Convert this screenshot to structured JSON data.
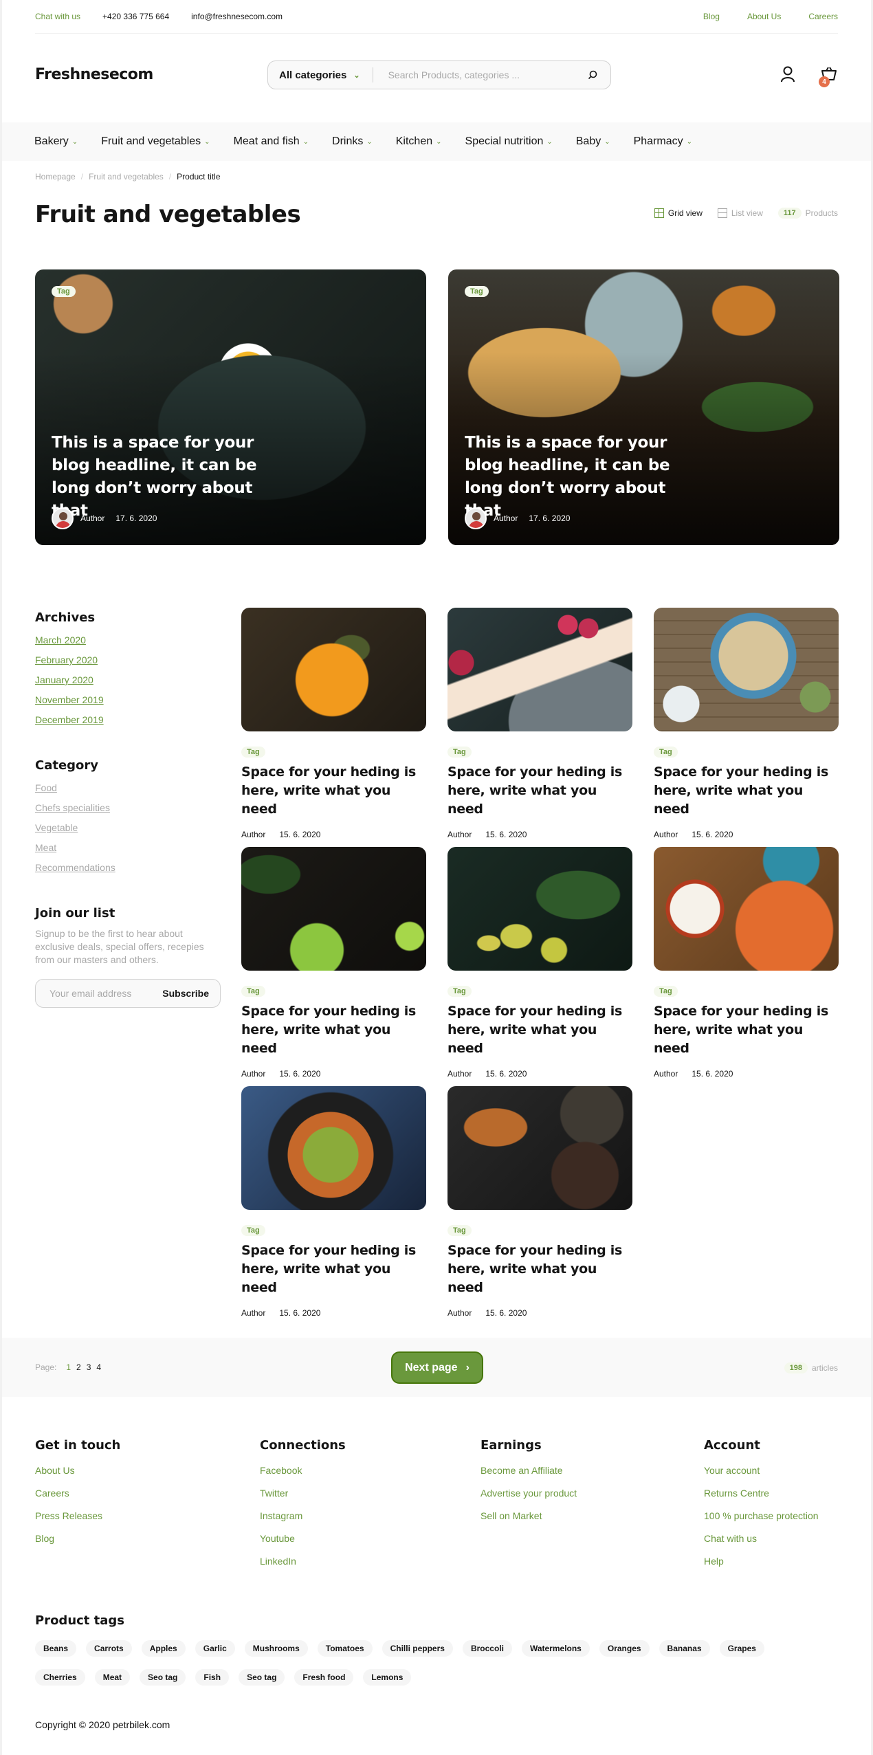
{
  "topbar": {
    "chat": "Chat with us",
    "phone": "+420 336 775 664",
    "email": "info@freshnesecom.com",
    "links": [
      "Blog",
      "About Us",
      "Careers"
    ]
  },
  "header": {
    "logo": "Freshnesecom",
    "category": "All categories",
    "search_placeholder": "Search Products, categories ...",
    "cart_count": "4"
  },
  "nav": [
    "Bakery",
    "Fruit and vegetables",
    "Meat and fish",
    "Drinks",
    "Kitchen",
    "Special nutrition",
    "Baby",
    "Pharmacy"
  ],
  "breadcrumb": [
    "Homepage",
    "Fruit and vegetables",
    "Product title"
  ],
  "page_title": "Fruit and vegetables",
  "view": {
    "grid": "Grid view",
    "list": "List view",
    "count": "117",
    "count_label": "Products"
  },
  "featured": [
    {
      "tag": "Tag",
      "title": "This is a space for your blog headline, it can be long don’t worry about that",
      "author": "Author",
      "date": "17. 6. 2020"
    },
    {
      "tag": "Tag",
      "title": "This is a space for your blog headline, it can be long don’t worry about that",
      "author": "Author",
      "date": "17. 6. 2020"
    }
  ],
  "sidebar": {
    "archives_title": "Archives",
    "archives": [
      "March 2020",
      "February 2020",
      "January 2020",
      "November 2019",
      "December 2019"
    ],
    "category_title": "Category",
    "categories": [
      "Food",
      "Chefs specialities",
      "Vegetable",
      "Meat",
      "Recommendations"
    ],
    "join_title": "Join our list",
    "join_desc": "Signup to be the first to hear about exclusive deals, special offers, recepies from our masters and others.",
    "email_placeholder": "Your email address",
    "subscribe": "Subscribe"
  },
  "posts": [
    {
      "tag": "Tag",
      "title": "Space for your heding is here, write what you need",
      "author": "Author",
      "date": "15. 6. 2020"
    },
    {
      "tag": "Tag",
      "title": "Space for your heding is here, write what you need",
      "author": "Author",
      "date": "15. 6. 2020"
    },
    {
      "tag": "Tag",
      "title": "Space for your heding is here, write what you need",
      "author": "Author",
      "date": "15. 6. 2020"
    },
    {
      "tag": "Tag",
      "title": "Space for your heding is here, write what you need",
      "author": "Author",
      "date": "15. 6. 2020"
    },
    {
      "tag": "Tag",
      "title": "Space for your heding is here, write what you need",
      "author": "Author",
      "date": "15. 6. 2020"
    },
    {
      "tag": "Tag",
      "title": "Space for your heding is here, write what you need",
      "author": "Author",
      "date": "15. 6. 2020"
    },
    {
      "tag": "Tag",
      "title": "Space for your heding is here, write what you need",
      "author": "Author",
      "date": "15. 6. 2020"
    },
    {
      "tag": "Tag",
      "title": "Space for your heding is here, write what you need",
      "author": "Author",
      "date": "15. 6. 2020"
    }
  ],
  "pagination": {
    "label": "Page:",
    "pages": [
      "1",
      "2",
      "3",
      "4"
    ],
    "next": "Next page",
    "count": "198",
    "count_label": "articles"
  },
  "footer": {
    "cols": [
      {
        "title": "Get in touch",
        "links": [
          "About Us",
          "Careers",
          "Press Releases",
          "Blog"
        ]
      },
      {
        "title": "Connections",
        "links": [
          "Facebook",
          "Twitter",
          "Instagram",
          "Youtube",
          "LinkedIn"
        ]
      },
      {
        "title": "Earnings",
        "links": [
          "Become an Affiliate",
          "Advertise your product",
          "Sell on Market"
        ]
      },
      {
        "title": "Account",
        "links": [
          "Your account",
          "Returns Centre",
          "100 % purchase protection",
          "Chat with us",
          "Help"
        ]
      }
    ],
    "tags_title": "Product tags",
    "tags": [
      "Beans",
      "Carrots",
      "Apples",
      "Garlic",
      "Mushrooms",
      "Tomatoes",
      "Chilli peppers",
      "Broccoli",
      "Watermelons",
      "Oranges",
      "Bananas",
      "Grapes",
      "Cherries",
      "Meat",
      "Seo tag",
      "Fish",
      "Seo tag",
      "Fresh food",
      "Lemons"
    ],
    "copyright": "Copyright © 2020 petrbilek.com"
  },
  "colors": {
    "accent": "#6a983c",
    "badge": "#e5704b",
    "tag_bg": "#f4f8ec"
  }
}
